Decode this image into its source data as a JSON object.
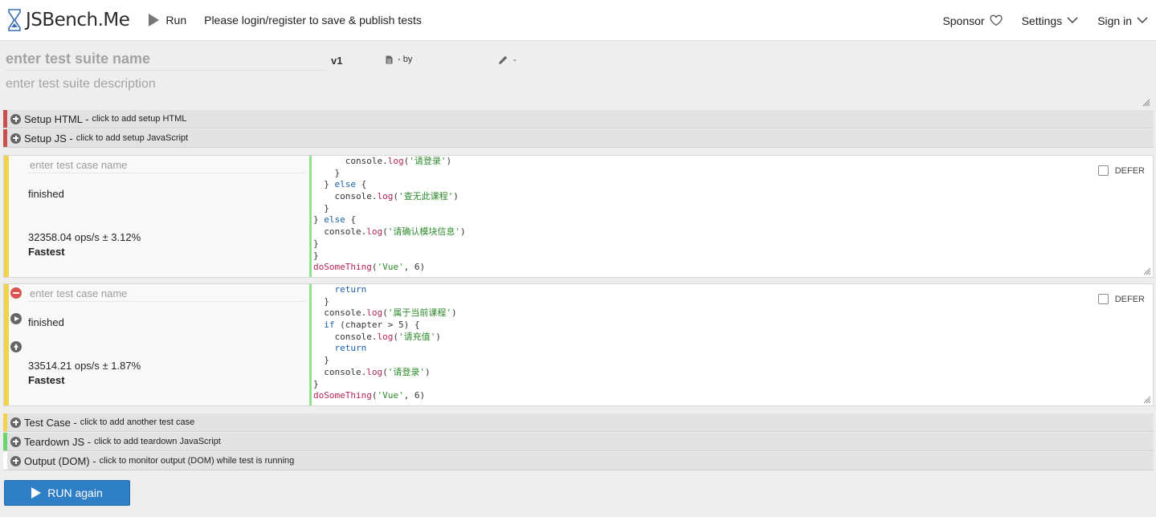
{
  "nav": {
    "brand": "JSBench.Me",
    "run_label": "Run",
    "message": "Please login/register to save & publish tests",
    "sponsor": "Sponsor",
    "settings": "Settings",
    "signin": "Sign in"
  },
  "suite": {
    "name_placeholder": "enter test suite name",
    "version": "v1",
    "meta_by": "- by",
    "meta_edit": "-",
    "desc_placeholder": "enter test suite description"
  },
  "sections": {
    "setup_html": {
      "title": "Setup HTML -",
      "hint": "click to add setup HTML",
      "color": "#c9504c"
    },
    "setup_js": {
      "title": "Setup JS -",
      "hint": "click to add setup JavaScript",
      "color": "#c9504c"
    },
    "test_case": {
      "title": "Test Case -",
      "hint": "click to add another test case",
      "color": "#f2d24b"
    },
    "teardown_js": {
      "title": "Teardown JS -",
      "hint": "click to add teardown JavaScript",
      "color": "#6cd66c"
    },
    "output_dom": {
      "title": "Output (DOM) -",
      "hint": "click to monitor output (DOM) while test is running",
      "color": "#ffffff"
    }
  },
  "test_cases": [
    {
      "name_placeholder": "enter test case name",
      "status": "finished",
      "ops": "32358.04 ops/s ± 3.12%",
      "rank": "Fastest",
      "defer_label": "DEFER"
    },
    {
      "name_placeholder": "enter test case name",
      "status": "finished",
      "ops": "33514.21 ops/s ± 1.87%",
      "rank": "Fastest",
      "defer_label": "DEFER"
    }
  ],
  "run_again_label": "RUN again",
  "colors": {
    "accent": "#2f7fc6",
    "testcase_bar": "#f2d24b",
    "code_border": "#8ee38e"
  }
}
